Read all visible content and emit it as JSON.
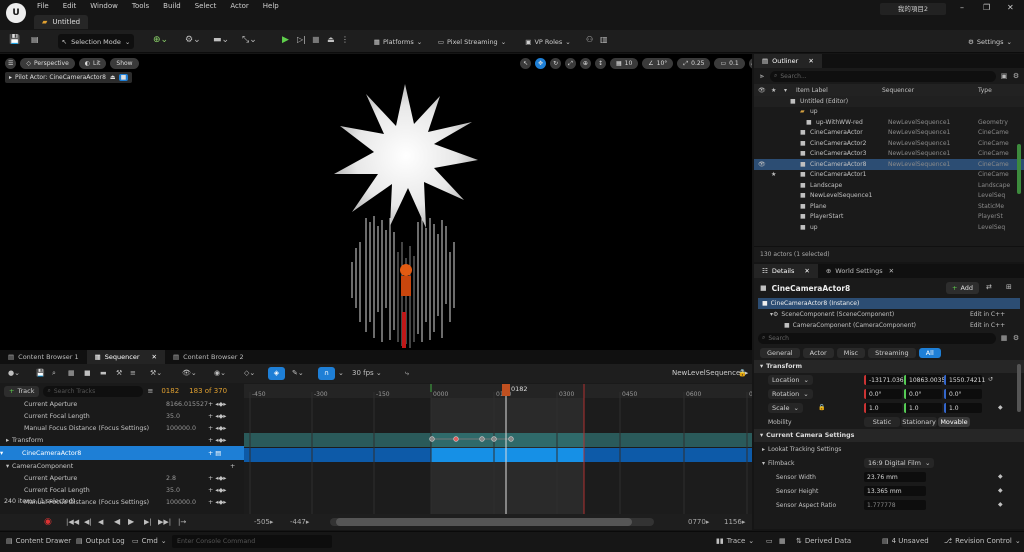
{
  "app": {
    "menu": [
      "File",
      "Edit",
      "Window",
      "Tools",
      "Build",
      "Select",
      "Actor",
      "Help"
    ],
    "project_name": "Untitled",
    "project_label": "我的項目2"
  },
  "toolbar": {
    "selection_mode": "Selection Mode",
    "platforms": "Platforms",
    "pixel_streaming": "Pixel Streaming",
    "vp_roles": "VP Roles",
    "settings": "Settings"
  },
  "viewport": {
    "perspective": "Perspective",
    "lit": "Lit",
    "show": "Show",
    "pilot": "Pilot Actor: CineCameraActor8",
    "grid": "10",
    "angle": "10°",
    "scale": "0.25",
    "cam_speed": "0.1"
  },
  "outliner": {
    "title": "Outliner",
    "search_placeholder": "Search...",
    "col_label": "Item Label",
    "col_seq": "Sequencer",
    "col_type": "Type",
    "rows": [
      {
        "label": "Untitled (Editor)",
        "seq": "",
        "type": ""
      },
      {
        "label": "up",
        "seq": "",
        "type": ""
      },
      {
        "label": "up-WithWW-red",
        "seq": "NewLevelSequence1",
        "type": "Geometry"
      },
      {
        "label": "CineCameraActor",
        "seq": "NewLevelSequence1",
        "type": "CineCame"
      },
      {
        "label": "CineCameraActor2",
        "seq": "NewLevelSequence1",
        "type": "CineCame"
      },
      {
        "label": "CineCameraActor3",
        "seq": "NewLevelSequence1",
        "type": "CineCame"
      },
      {
        "label": "CineCameraActor8",
        "seq": "NewLevelSequence1",
        "type": "CineCame"
      },
      {
        "label": "CineCameraActor1",
        "seq": "",
        "type": "CineCame"
      },
      {
        "label": "Landscape",
        "seq": "",
        "type": "Landscape"
      },
      {
        "label": "NewLevelSequence1",
        "seq": "",
        "type": "LevelSeq"
      },
      {
        "label": "Plane",
        "seq": "",
        "type": "StaticMe"
      },
      {
        "label": "PlayerStart",
        "seq": "",
        "type": "PlayerSt"
      },
      {
        "label": "up",
        "seq": "",
        "type": "LevelSeq"
      }
    ],
    "status": "130 actors (1 selected)"
  },
  "details": {
    "tab": "Details",
    "tab2": "World Settings",
    "actor": "CineCameraActor8",
    "add": "Add",
    "instance": "CineCameraActor8 (Instance)",
    "scene_component": "SceneComponent (SceneComponent)",
    "camera_component": "CameraComponent (CameraComponent)",
    "edit_cpp": "Edit in C++",
    "search_placeholder": "Search",
    "filters": [
      "General",
      "Actor",
      "Misc",
      "Streaming",
      "All"
    ],
    "transform": "Transform",
    "location": "Location",
    "loc": [
      "-13171.036",
      "10863.0035",
      "1550.74211"
    ],
    "rotation": "Rotation",
    "rot": [
      "0.0°",
      "0.0°",
      "0.0°"
    ],
    "scale": "Scale",
    "scl": [
      "1.0",
      "1.0",
      "1.0"
    ],
    "mobility": "Mobility",
    "mob": [
      "Static",
      "Stationary",
      "Movable"
    ],
    "current_camera": "Current Camera Settings",
    "lookat": "Lookat Tracking Settings",
    "filmback": "Filmback",
    "filmback_val": "16:9 Digital Film",
    "sensor_width": "Sensor Width",
    "sensor_width_val": "23.76 mm",
    "sensor_height": "Sensor Height",
    "sensor_height_val": "13.365 mm",
    "sensor_aspect": "Sensor Aspect Ratio",
    "sensor_aspect_val": "1.777778"
  },
  "seq_tabs": [
    "Content Browser 1",
    "Sequencer",
    "Content Browser 2"
  ],
  "sequencer": {
    "fps": "30 fps",
    "sequence_name": "NewLevelSequence1",
    "track_btn": "Track",
    "search_placeholder": "Search Tracks",
    "current_frame": "0182",
    "frame_count": "183 of 370",
    "rows": [
      {
        "label": "Current Aperture",
        "value": "8166.015527",
        "indent": 3
      },
      {
        "label": "Current Focal Length",
        "value": "35.0",
        "indent": 3
      },
      {
        "label": "Manual Focus Distance (Focus Settings)",
        "value": "100000.0",
        "indent": 3
      },
      {
        "label": "Transform",
        "value": "",
        "indent": 2
      },
      {
        "label": "CineCameraActor8",
        "value": "",
        "indent": 1
      },
      {
        "label": "CameraComponent",
        "value": "",
        "indent": 2
      },
      {
        "label": "Current Aperture",
        "value": "2.8",
        "indent": 3
      },
      {
        "label": "Current Focal Length",
        "value": "35.0",
        "indent": 3
      },
      {
        "label": "Manual Focus Distance (Focus Settings)",
        "value": "100000.0",
        "indent": 3
      }
    ],
    "items_status": "240 items (1 selected)",
    "ticks": [
      "-450",
      "-300",
      "-150",
      "0000",
      "0150",
      "0300",
      "0450",
      "0600",
      "07"
    ],
    "playhead": "0182",
    "range_start": "-505",
    "range_view_start": "-447",
    "range_view_end": "0770",
    "range_end": "1156"
  },
  "status": {
    "content_drawer": "Content Drawer",
    "output_log": "Output Log",
    "cmd": "Cmd",
    "console_placeholder": "Enter Console Command",
    "trace": "Trace",
    "derived": "Derived Data",
    "unsaved": "4 Unsaved",
    "revision": "Revision Control"
  }
}
